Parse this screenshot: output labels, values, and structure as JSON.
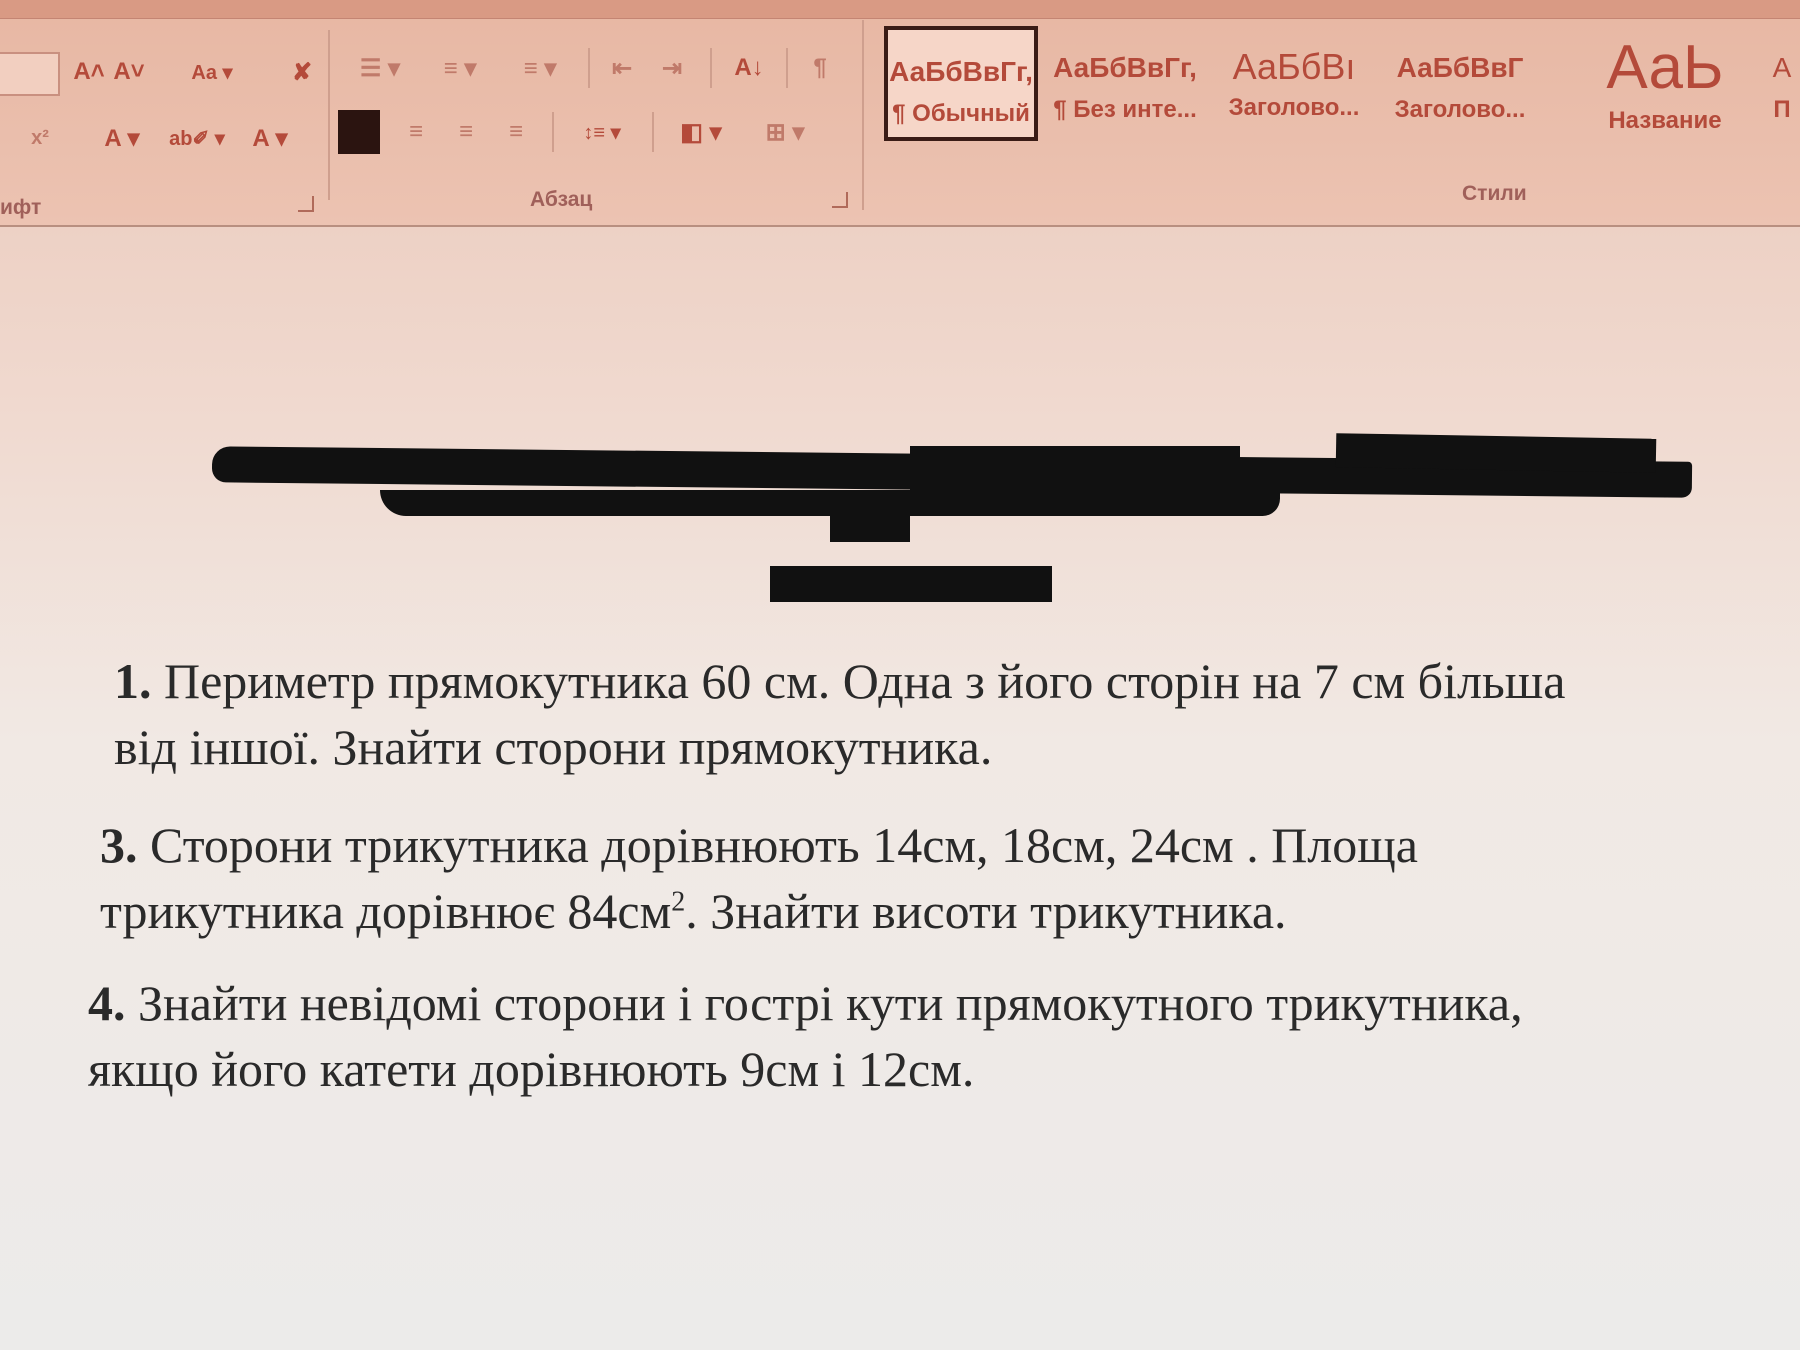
{
  "ribbon": {
    "groups": {
      "font_label": "ифт",
      "paragraph_label": "Абзац",
      "styles_label": "Стили"
    },
    "font_tools": {
      "grow": "A˄",
      "shrink": "A˅",
      "case": "Aa ▾",
      "clear": "✘",
      "superscript": "x²",
      "effects": "A ▾",
      "highlight": "ab✐ ▾",
      "font_color": "A ▾"
    },
    "paragraph_tools": {
      "bullets": "☰ ▾",
      "numbering": "≡ ▾",
      "multilevel": "≡ ▾",
      "decrease_indent": "⇤",
      "increase_indent": "⇥",
      "sort": "A↓",
      "show_marks": "¶",
      "line_spacing": "↕≡ ▾",
      "shading": "◧ ▾",
      "borders": "⊞ ▾"
    },
    "styles": [
      {
        "sample": "АаБбВвГг,",
        "name": "¶ Обычный",
        "selected": true
      },
      {
        "sample": "АаБбВвГг,",
        "name": "¶ Без инте...",
        "selected": false
      },
      {
        "sample": "АаБбВı",
        "name": "Заголово...",
        "selected": false
      },
      {
        "sample": "АаБбВвГ",
        "name": "Заголово...",
        "selected": false
      },
      {
        "sample": "АаЬ",
        "name": "Название",
        "selected": false
      },
      {
        "sample": "А",
        "name": "П",
        "selected": false
      }
    ]
  },
  "document": {
    "problems": [
      {
        "number": "1.",
        "line1": "Периметр прямокутника 60 см. Одна з його сторін на 7 см більша",
        "line2": "від іншої. Знайти сторони прямокутника."
      },
      {
        "number": "3.",
        "line1": "Сторони трикутника дорівнюють 14см, 18см, 24см . Площа",
        "line2_pre": "трикутника дорівнює 84см",
        "line2_sup": "2",
        "line2_post": ". Знайти висоти трикутника."
      },
      {
        "number": "4.",
        "line1": "Знайти невідомі сторони і гострі кути прямокутного трикутника,",
        "line2": "якщо його катети дорівнюють 9см і 12см."
      }
    ]
  }
}
